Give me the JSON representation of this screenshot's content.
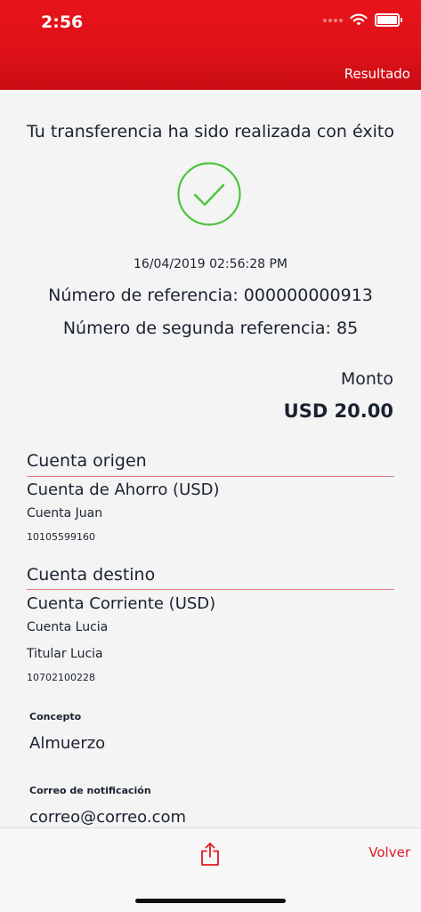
{
  "status_bar": {
    "time": "2:56"
  },
  "nav": {
    "title": "Resultado"
  },
  "result": {
    "headline": "Tu transferencia ha sido realizada con éxito",
    "datetime": "16/04/2019 02:56:28 PM",
    "reference": "Número de referencia: 000000000913",
    "second_reference": "Número de segunda referencia: 85",
    "amount_label": "Monto",
    "amount": "USD 20.00"
  },
  "origin": {
    "title": "Cuenta origen",
    "account_type": "Cuenta de Ahorro (USD)",
    "account_name": "Cuenta Juan",
    "account_number": "10105599160"
  },
  "destination": {
    "title": "Cuenta destino",
    "account_type": "Cuenta Corriente (USD)",
    "account_name": "Cuenta Lucia",
    "holder": "Titular Lucia",
    "account_number": "10702100228"
  },
  "concept": {
    "label": "Concepto",
    "value": "Almuerzo"
  },
  "notification": {
    "label": "Correo de notificación",
    "value": "correo@correo.com"
  },
  "toolbar": {
    "back_label": "Volver",
    "share_icon": "share-icon"
  },
  "colors": {
    "brand_red": "#e3141b",
    "success_green": "#4bc43b",
    "divider": "#e07a7c"
  }
}
